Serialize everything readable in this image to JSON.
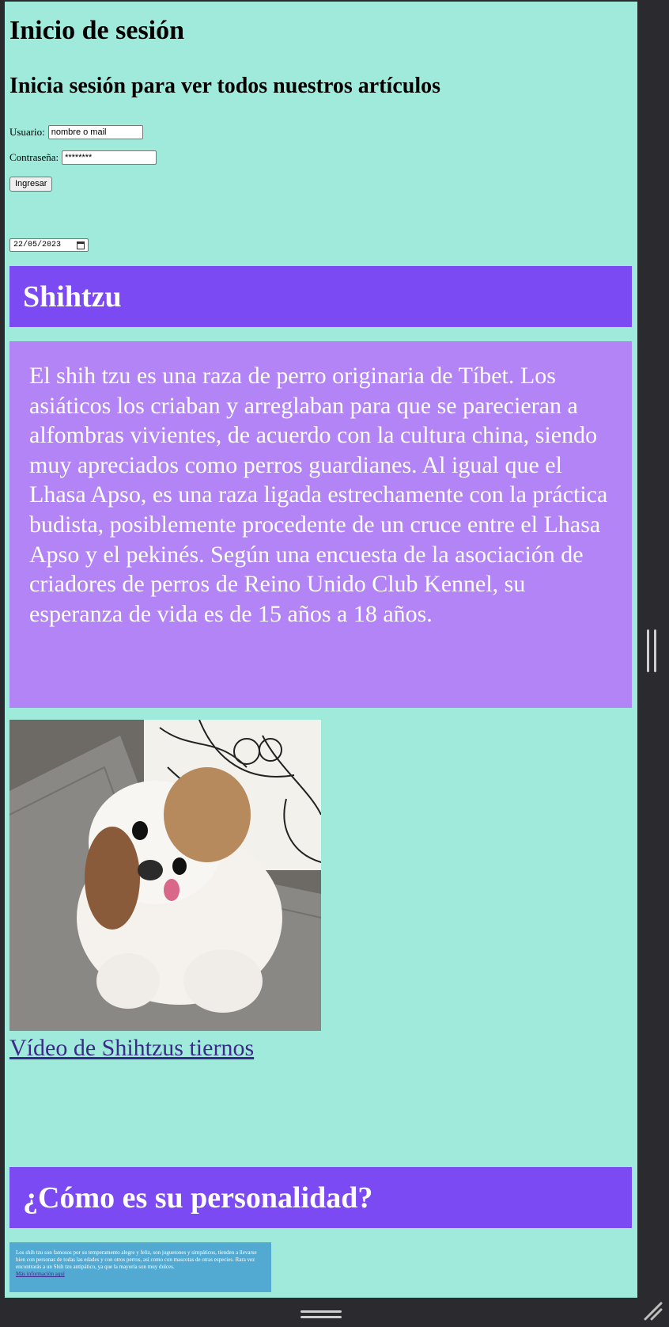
{
  "login": {
    "heading": "Inicio de sesión",
    "subheading": "Inicia sesión para ver todos nuestros artículos",
    "user_label": "Usuario:",
    "user_value": "nombre o mail",
    "pass_label": "Contraseña:",
    "pass_value": "********",
    "submit_label": "Ingresar"
  },
  "date_input": {
    "value": "22/05/2023"
  },
  "section1": {
    "title": "Shihtzu",
    "description": "El shih tzu es una raza de perro originaria de Tíbet. Los asiáticos los criaban y arreglaban para que se parecieran a alfombras vivientes, de acuerdo con la cultura china, siendo muy apreciados como perros guardianes. Al igual que el Lhasa Apso, es una raza ligada estrechamente con la práctica budista, posiblemente procedente de un cruce entre el Lhasa Apso y el pekinés. Según una encuesta de la asociación de criadores de perros de Reino Unido Club Kennel, su esperanza de vida es de 15 años a 18 años.",
    "video_link": "Vídeo de Shihtzus tiernos"
  },
  "section2": {
    "title": "¿Cómo es su personalidad?",
    "text": "Los shih tzu son famosos por su temperamento alegre y feliz, son juguetones y simpáticos, tienden a llevarse bien con personas de todas las edades y con otros perros, así como con mascotas de otras especies. Rara vez encontrarás a un Shih tzu antipático, ya que la mayoría son muy dulces.",
    "link": "Más información aquí"
  },
  "colors": {
    "page_bg": "#a0eadc",
    "banner": "#7b4af2",
    "description_bg": "#b384f5",
    "small_box_bg": "#52aad2",
    "link": "#3b2a8a"
  }
}
